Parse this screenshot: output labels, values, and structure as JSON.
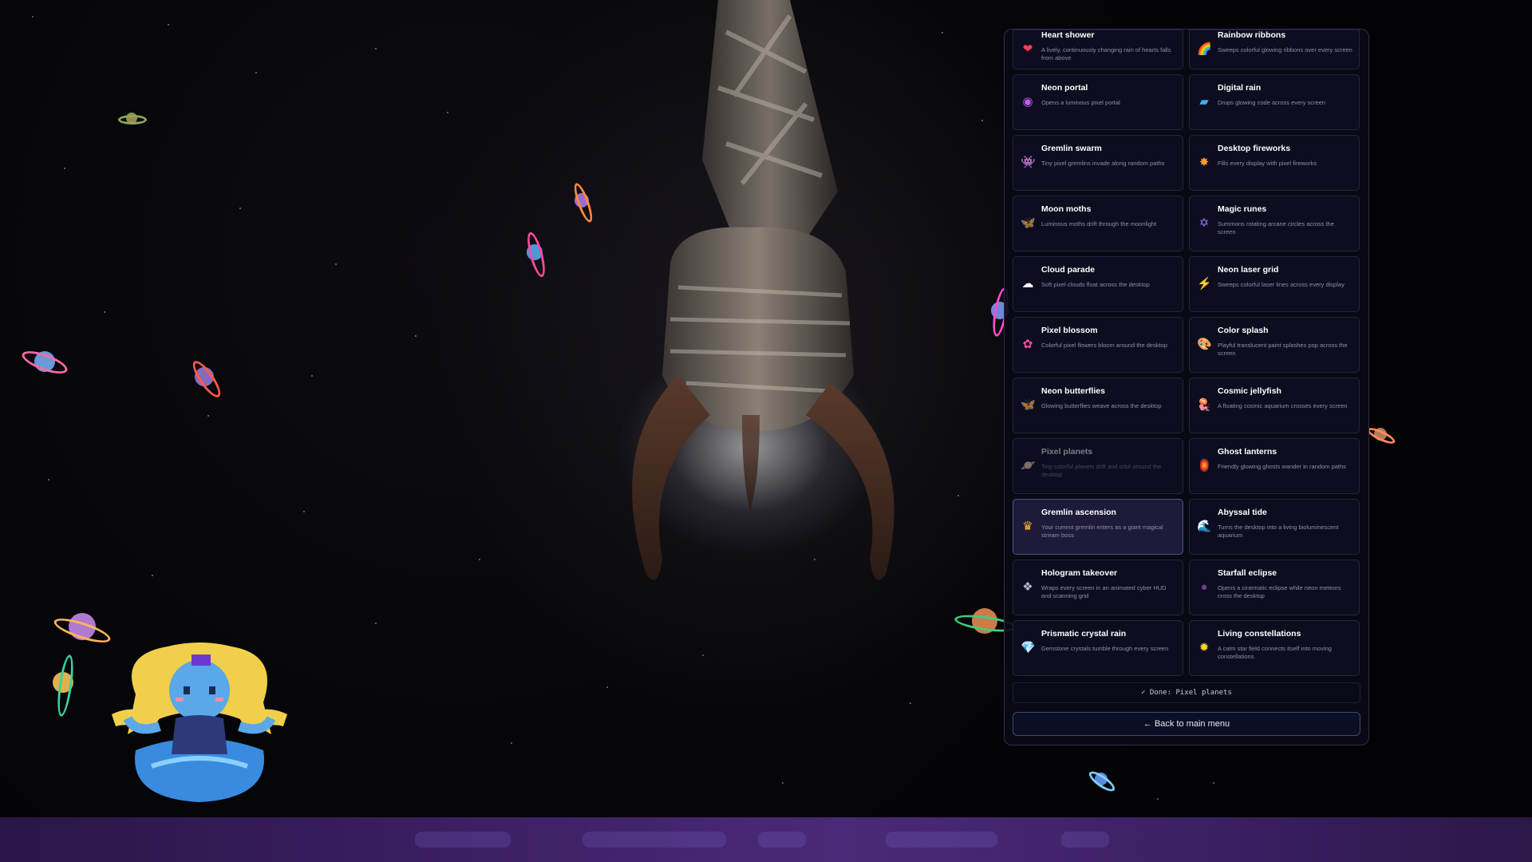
{
  "effects_panel": {
    "items": [
      {
        "title": "Heart shower",
        "desc": "A lively, continuously changing rain of hearts falls from above",
        "icon": "heart-icon",
        "glyph": "❤",
        "color": "#ff3b5c"
      },
      {
        "title": "Rainbow ribbons",
        "desc": "Sweeps colorful glowing ribbons over every screen",
        "icon": "rainbow-icon",
        "glyph": "🌈",
        "color": "#ffb02e"
      },
      {
        "title": "Neon portal",
        "desc": "Opens a luminous pixel portal",
        "icon": "portal-icon",
        "glyph": "◉",
        "color": "#c45cff"
      },
      {
        "title": "Digital rain",
        "desc": "Drops glowing code across every screen",
        "icon": "computer-icon",
        "glyph": "▰",
        "color": "#3ab0ff"
      },
      {
        "title": "Gremlin swarm",
        "desc": "Tiny pixel gremlins invade along random paths",
        "icon": "gremlin-icon",
        "glyph": "👾",
        "color": "#8a8cff"
      },
      {
        "title": "Desktop fireworks",
        "desc": "Fills every display with pixel fireworks",
        "icon": "fireworks-icon",
        "glyph": "✸",
        "color": "#ff9d2e"
      },
      {
        "title": "Moon moths",
        "desc": "Luminous moths drift through the moonlight",
        "icon": "moth-icon",
        "glyph": "🦋",
        "color": "#ff6a3d"
      },
      {
        "title": "Magic runes",
        "desc": "Summons rotating arcane circles across the screen",
        "icon": "rune-icon",
        "glyph": "✡",
        "color": "#a77bff"
      },
      {
        "title": "Cloud parade",
        "desc": "Soft pixel clouds float across the desktop",
        "icon": "cloud-icon",
        "glyph": "☁",
        "color": "#ffffff"
      },
      {
        "title": "Neon laser grid",
        "desc": "Sweeps colorful laser lines across every display",
        "icon": "lightning-icon",
        "glyph": "⚡",
        "color": "#ff7a1a"
      },
      {
        "title": "Pixel blossom",
        "desc": "Colorful pixel flowers bloom around the desktop",
        "icon": "flower-icon",
        "glyph": "✿",
        "color": "#ff4fa3"
      },
      {
        "title": "Color splash",
        "desc": "Playful translucent paint splashes pop across the screen",
        "icon": "palette-icon",
        "glyph": "🎨",
        "color": "#ff8a7a"
      },
      {
        "title": "Neon butterflies",
        "desc": "Glowing butterflies weave across the desktop",
        "icon": "butterfly-icon",
        "glyph": "🦋",
        "color": "#ff5a2e"
      },
      {
        "title": "Cosmic jellyfish",
        "desc": "A floating cosmic aquarium crosses every screen",
        "icon": "jellyfish-icon",
        "glyph": "🪼",
        "color": "#6fa8ff"
      },
      {
        "title": "Pixel planets",
        "desc": "Tiny colorful planets drift and orbit around the desktop",
        "icon": "planet-icon",
        "glyph": "🪐",
        "color": "#e0a85a",
        "dim": true
      },
      {
        "title": "Ghost lanterns",
        "desc": "Friendly glowing ghosts wander in random paths",
        "icon": "lantern-icon",
        "glyph": "🏮",
        "color": "#ff4a3a"
      },
      {
        "title": "Gremlin ascension",
        "desc": "Your current gremlin enters as a giant magical stream boss",
        "icon": "crown-icon",
        "glyph": "♛",
        "color": "#ffb52e",
        "selected": true
      },
      {
        "title": "Abyssal tide",
        "desc": "Turns the desktop into a living bioluminescent aquarium",
        "icon": "wave-icon",
        "glyph": "🌊",
        "color": "#3ac0ff"
      },
      {
        "title": "Hologram takeover",
        "desc": "Wraps every screen in an animated cyber HUD and scanning grid",
        "icon": "hologram-icon",
        "glyph": "❖",
        "color": "#b6b8d8"
      },
      {
        "title": "Starfall eclipse",
        "desc": "Opens a cinematic eclipse while neon meteors cross the desktop",
        "icon": "eclipse-icon",
        "glyph": "●",
        "color": "#6b3f8c"
      },
      {
        "title": "Prismatic crystal rain",
        "desc": "Gemstone crystals tumble through every screen",
        "icon": "gem-icon",
        "glyph": "💎",
        "color": "#4fc8ff"
      },
      {
        "title": "Living constellations",
        "desc": "A calm star field connects itself into moving constellations",
        "icon": "star-icon",
        "glyph": "✹",
        "color": "#ffd52e"
      }
    ],
    "status": "✓ Done: Pixel planets",
    "back_label": "← Back to main menu"
  }
}
